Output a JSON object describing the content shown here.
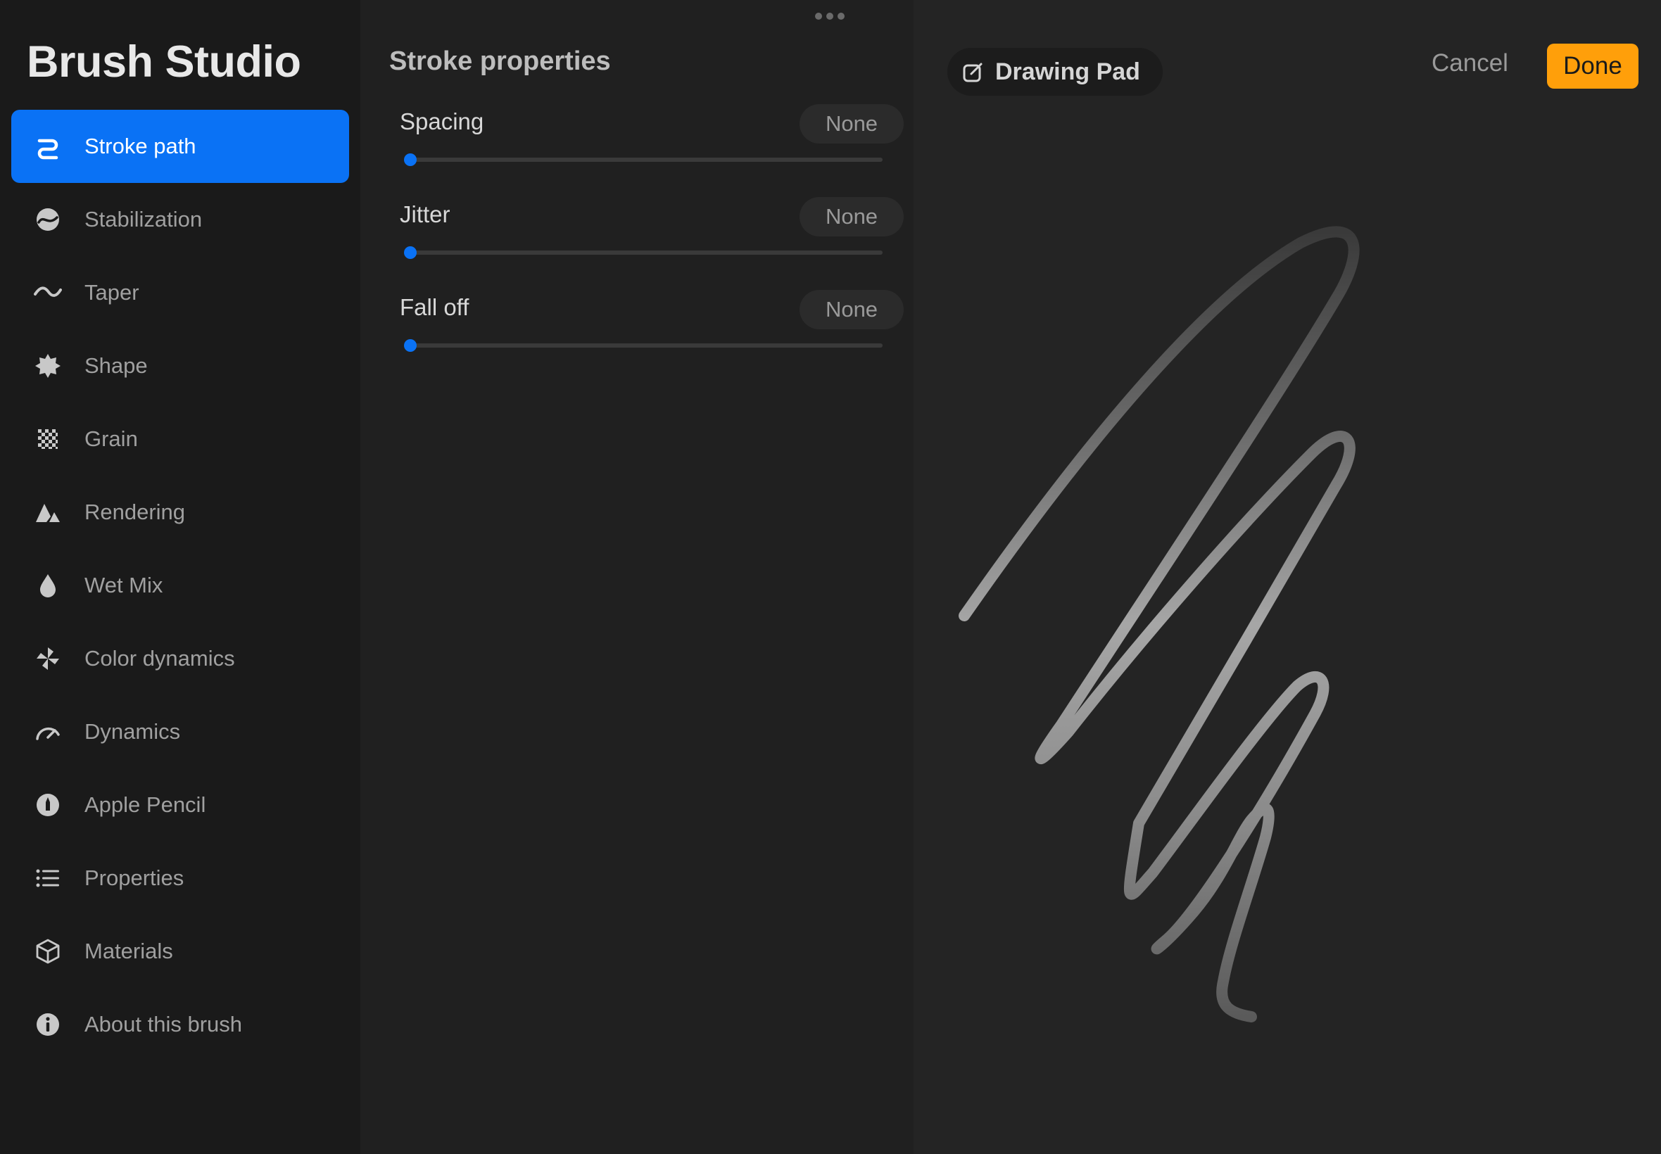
{
  "app_title": "Brush Studio",
  "sidebar": {
    "items": [
      {
        "label": "Stroke path",
        "icon": "stroke-path-icon",
        "active": true
      },
      {
        "label": "Stabilization",
        "icon": "stabilization-icon",
        "active": false
      },
      {
        "label": "Taper",
        "icon": "taper-icon",
        "active": false
      },
      {
        "label": "Shape",
        "icon": "shape-icon",
        "active": false
      },
      {
        "label": "Grain",
        "icon": "grain-icon",
        "active": false
      },
      {
        "label": "Rendering",
        "icon": "rendering-icon",
        "active": false
      },
      {
        "label": "Wet Mix",
        "icon": "wet-mix-icon",
        "active": false
      },
      {
        "label": "Color dynamics",
        "icon": "color-dynamics-icon",
        "active": false
      },
      {
        "label": "Dynamics",
        "icon": "dynamics-icon",
        "active": false
      },
      {
        "label": "Apple Pencil",
        "icon": "apple-pencil-icon",
        "active": false
      },
      {
        "label": "Properties",
        "icon": "properties-icon",
        "active": false
      },
      {
        "label": "Materials",
        "icon": "materials-icon",
        "active": false
      },
      {
        "label": "About this brush",
        "icon": "info-icon",
        "active": false
      }
    ]
  },
  "panel": {
    "title": "Stroke properties",
    "sliders": [
      {
        "label": "Spacing",
        "value_text": "None",
        "value": 0
      },
      {
        "label": "Jitter",
        "value_text": "None",
        "value": 0
      },
      {
        "label": "Fall off",
        "value_text": "None",
        "value": 0
      }
    ]
  },
  "pad": {
    "tab_label": "Drawing Pad",
    "cancel_label": "Cancel",
    "done_label": "Done"
  },
  "colors": {
    "accent": "#0a72f5",
    "done": "#ff9f0a",
    "background": "#1a1a1a",
    "panel": "#202020",
    "pad": "#242424"
  }
}
